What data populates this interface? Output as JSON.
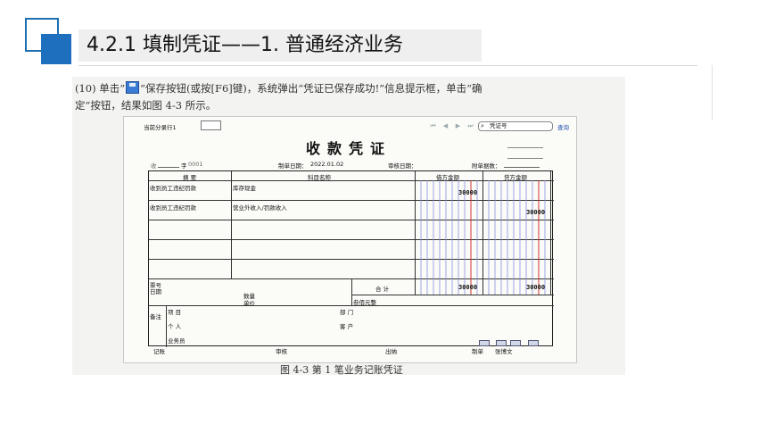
{
  "slide": {
    "title": "4.2.1  填制凭证——1. 普通经济业务"
  },
  "paragraph": {
    "line1_a": "(10) 单击“",
    "line1_b": "”保存按钮(或按[F6]键)，系统弹出“凭证已保存成功!”信息提示框，单击“确",
    "line2": "定”按钮，结果如图 4-3 所示。",
    "save_icon": "save-icon"
  },
  "voucher": {
    "current_entry_label": "当前分录行1",
    "search_placeholder": "凭证号",
    "query_label": "查询",
    "title": "收款凭证",
    "type_char": "收",
    "number_label": "字",
    "number_value": "0001",
    "date_label": "制单日期：",
    "date_value": "2022.01.02",
    "audit_date_label": "审核日期：",
    "attachments_label": "附单据数：",
    "headers": {
      "summary": "摘 要",
      "account": "科目名称",
      "debit": "借方金额",
      "credit": "贷方金额"
    },
    "rows": [
      {
        "summary": "收到员工违纪罚款",
        "account": "库存现金",
        "debit": "30000",
        "credit": ""
      },
      {
        "summary": "收到员工违纪罚款",
        "account": "营业外收入/罚款收入",
        "debit": "",
        "credit": "30000"
      }
    ],
    "ticket_no_label": "票号",
    "date_field_label": "日期",
    "quantity_label": "数量",
    "unit_price_label": "单价",
    "total_label": "合 计",
    "total_debit": "30000",
    "total_credit": "30000",
    "total_words": "叁佰元整",
    "remarks_label": "备注",
    "project_label": "项 目",
    "department_label": "部 门",
    "individual_label": "个 人",
    "customer_label": "客 户",
    "salesperson_label": "业务员",
    "footer": {
      "bookkeeping": "记账",
      "audit": "审核",
      "cashier": "出纳",
      "preparer_label": "制单",
      "preparer": "张博文"
    },
    "colors": {
      "ledger_blue": "#8890e0",
      "ledger_red": "#d23030"
    }
  },
  "caption": "图 4-3  第 1 笔业务记账凭证"
}
